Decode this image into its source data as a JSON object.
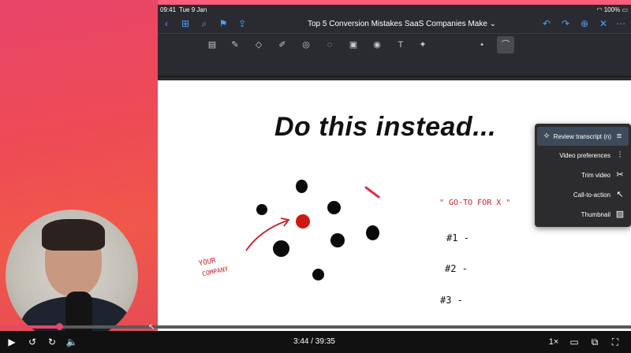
{
  "status_bar": {
    "time": "09:41",
    "date": "Tue 9 Jan",
    "battery": "100%"
  },
  "document": {
    "title": "Top 5 Conversion Mistakes SaaS Companies Make ⌄"
  },
  "whiteboard": {
    "headline": "Do this instead...",
    "your_company_line1": "YOUR",
    "your_company_line2": "COMPANY",
    "goto_label": "\" GO-TO   FOR X \"",
    "item1": "#1 -",
    "item2": "#2 -",
    "item3": "#3 -"
  },
  "menu": {
    "items": [
      {
        "label": "Review transcript (n)",
        "icon": "sparkle-transcript-icon"
      },
      {
        "label": "Video preferences",
        "icon": "sliders-icon"
      },
      {
        "label": "Trim video",
        "icon": "scissors-icon"
      },
      {
        "label": "Call-to-action",
        "icon": "cursor-click-icon"
      },
      {
        "label": "Thumbnail",
        "icon": "image-icon"
      }
    ]
  },
  "player": {
    "current_time": "3:44",
    "duration": "39:35",
    "time_display": "3:44 / 39:35",
    "progress": 0.094,
    "speed": "1×"
  },
  "colors": {
    "accent": "#e8456a",
    "red_dot": "#cc1a12",
    "handwriting_red": "#c81e2a"
  }
}
